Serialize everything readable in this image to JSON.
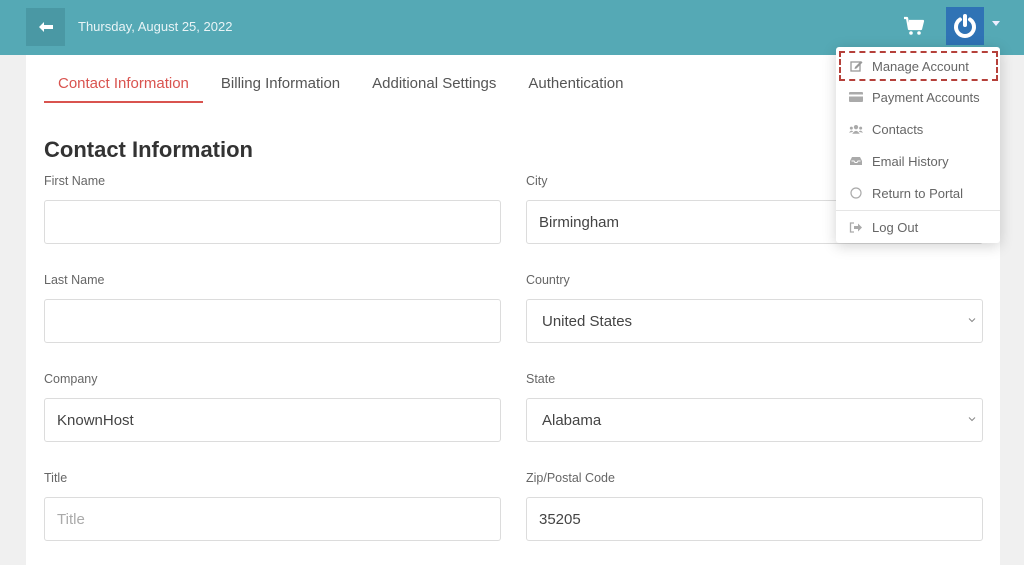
{
  "header": {
    "date": "Thursday, August 25, 2022",
    "back_icon": "arrow-left-icon",
    "cart_icon": "cart-icon",
    "account_icon": "power-icon",
    "brand_color": "#55a9b5",
    "account_color": "#2f73b5"
  },
  "tabs": [
    {
      "label": "Contact Information",
      "active": true
    },
    {
      "label": "Billing Information",
      "active": false
    },
    {
      "label": "Additional Settings",
      "active": false
    },
    {
      "label": "Authentication",
      "active": false
    }
  ],
  "form": {
    "title": "Contact Information",
    "first_name": {
      "label": "First Name",
      "value": ""
    },
    "last_name": {
      "label": "Last Name",
      "value": ""
    },
    "company": {
      "label": "Company",
      "value": "KnownHost"
    },
    "title_field": {
      "label": "Title",
      "value": "",
      "placeholder": "Title"
    },
    "city": {
      "label": "City",
      "value": "Birmingham"
    },
    "country": {
      "label": "Country",
      "value": "United States"
    },
    "state": {
      "label": "State",
      "value": "Alabama"
    },
    "zip": {
      "label": "Zip/Postal Code",
      "value": "35205"
    }
  },
  "account_menu": {
    "items": [
      {
        "label": "Manage Account",
        "icon": "edit-icon",
        "highlighted": true
      },
      {
        "label": "Payment Accounts",
        "icon": "credit-card-icon"
      },
      {
        "label": "Contacts",
        "icon": "users-icon"
      },
      {
        "label": "Email History",
        "icon": "inbox-icon"
      },
      {
        "label": "Return to Portal",
        "icon": "circle-icon"
      },
      {
        "label": "Log Out",
        "icon": "sign-out-icon"
      }
    ],
    "accent_color": "#d9534f"
  }
}
